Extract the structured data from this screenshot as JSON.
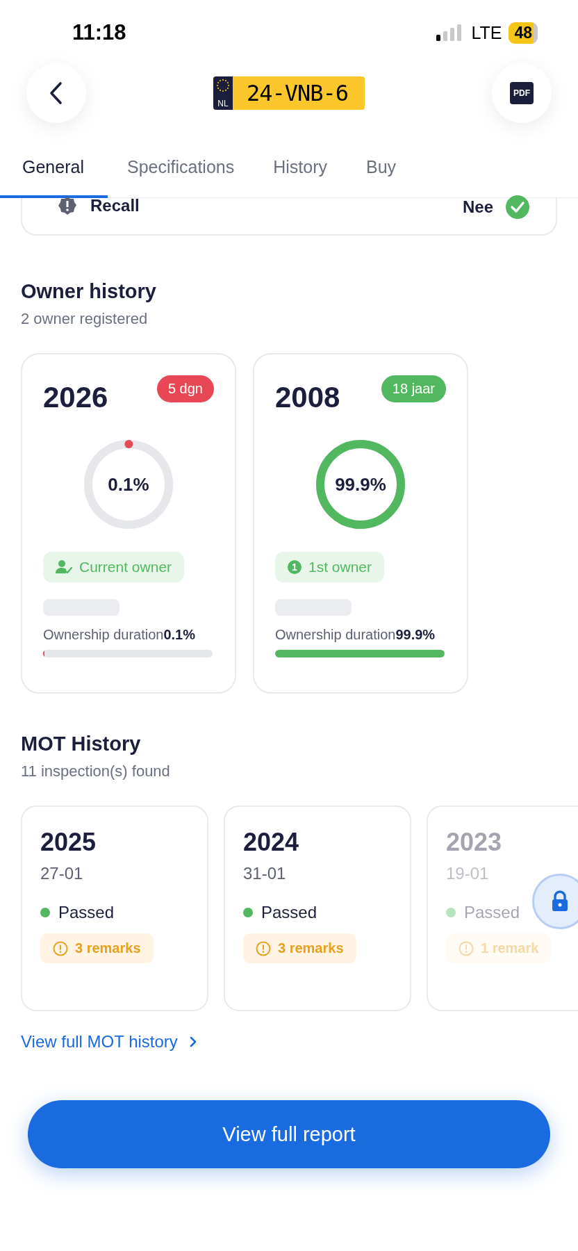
{
  "status_bar": {
    "time": "11:18",
    "network": "LTE",
    "battery": "48"
  },
  "header": {
    "plate_country": "NL",
    "plate": "24-VNB-6",
    "pdf_label": "PDF"
  },
  "tabs": [
    {
      "label": "General",
      "selected": true
    },
    {
      "label": "Specifications",
      "selected": false
    },
    {
      "label": "History",
      "selected": false
    },
    {
      "label": "Buy",
      "selected": false
    }
  ],
  "recall_row": {
    "label": "Recall",
    "value": "Nee",
    "ok": true
  },
  "owner_history": {
    "title": "Owner history",
    "subtitle": "2 owner registered",
    "owners": [
      {
        "year": "2026",
        "badge": "5 dgn",
        "color": "#e84855",
        "percent": "0.1%",
        "level": 0.001,
        "tag": {
          "kind": "current",
          "label": "Current owner"
        },
        "duration_label": "Ownership duration",
        "duration_value": "0.1%"
      },
      {
        "year": "2008",
        "badge": "18 jaar",
        "color": "#52b860",
        "percent": "99.9%",
        "level": 0.999,
        "tag": {
          "kind": "number",
          "number": "1",
          "label": "1st owner"
        },
        "duration_label": "Ownership duration",
        "duration_value": "99.9%"
      }
    ]
  },
  "mot_history": {
    "title": "MOT History",
    "subtitle": "11 inspection(s) found",
    "inspections": [
      {
        "year": "2025",
        "date": "27-01",
        "status": "Passed",
        "remarks": "3 remarks",
        "locked": false
      },
      {
        "year": "2024",
        "date": "31-01",
        "status": "Passed",
        "remarks": "3 remarks",
        "locked": false
      },
      {
        "year": "2023",
        "date": "19-01",
        "status": "Passed",
        "remarks": "1 remark",
        "locked": true
      }
    ],
    "link": "View full MOT history"
  },
  "primary_button": "View full report"
}
